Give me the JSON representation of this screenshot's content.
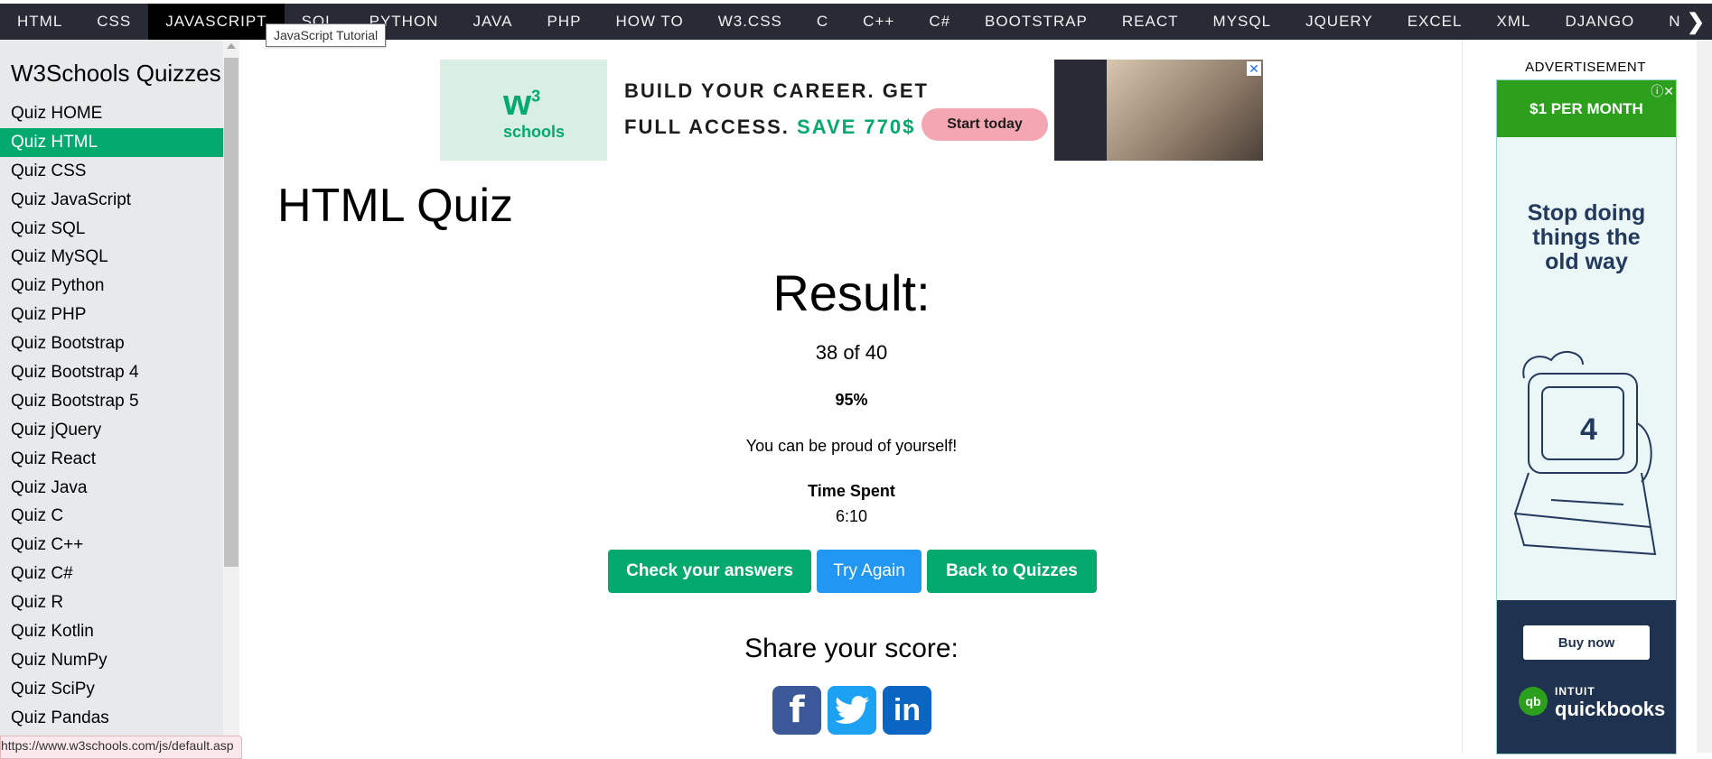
{
  "topnav": {
    "items": [
      "HTML",
      "CSS",
      "JAVASCRIPT",
      "SQL",
      "PYTHON",
      "JAVA",
      "PHP",
      "HOW TO",
      "W3.CSS",
      "C",
      "C++",
      "C#",
      "BOOTSTRAP",
      "REACT",
      "MYSQL",
      "JQUERY",
      "EXCEL",
      "XML",
      "DJANGO",
      "NUMPY"
    ],
    "active_item": "JAVASCRIPT",
    "tooltip": "JavaScript Tutorial",
    "chevron": "❯"
  },
  "sidebar": {
    "title": "W3Schools Quizzes",
    "items": [
      "Quiz HOME",
      "Quiz HTML",
      "Quiz CSS",
      "Quiz JavaScript",
      "Quiz SQL",
      "Quiz MySQL",
      "Quiz Python",
      "Quiz PHP",
      "Quiz Bootstrap",
      "Quiz Bootstrap 4",
      "Quiz Bootstrap 5",
      "Quiz jQuery",
      "Quiz React",
      "Quiz Java",
      "Quiz C",
      "Quiz C++",
      "Quiz C#",
      "Quiz R",
      "Quiz Kotlin",
      "Quiz NumPy",
      "Quiz SciPy",
      "Quiz Pandas"
    ],
    "active_item": "Quiz HTML"
  },
  "status_url": "https://www.w3schools.com/js/default.asp",
  "banner": {
    "logo_main": "w",
    "logo_sup": "3",
    "logo_sub": "schools",
    "line1": "BUILD YOUR CAREER. GET",
    "line2_prefix": "FULL ACCESS.",
    "line2_highlight": "SAVE 770$",
    "button": "Start today",
    "close": "✕"
  },
  "main": {
    "page_title": "HTML Quiz",
    "result_heading": "Result:",
    "score_text": "38 of 40",
    "percent_text": "95%",
    "message": "You can be proud of yourself!",
    "time_label": "Time Spent",
    "time_value": "6:10",
    "buttons": {
      "check": "Check your answers",
      "try_again": "Try Again",
      "back": "Back to Quizzes"
    },
    "share_heading": "Share your score:",
    "social": {
      "facebook": "f",
      "linkedin": "in"
    }
  },
  "right_ad": {
    "label": "ADVERTISEMENT",
    "price_bar": "$1 PER MONTH",
    "close": "ⓘ✕",
    "headline_lines": [
      "Stop doing",
      "things the",
      "old way"
    ],
    "illustration_number": "4",
    "buy_button": "Buy now",
    "brand_mark": "qb",
    "brand_company": "INTUIT",
    "brand_product": "quickbooks"
  },
  "colors": {
    "nav_bg": "#282a35",
    "accent_green": "#04aa6d",
    "button_blue": "#2196f3",
    "sidebar_bg": "#e7e9eb",
    "facebook": "#3b5998",
    "twitter": "#1da1f2",
    "linkedin": "#0a66c2"
  }
}
